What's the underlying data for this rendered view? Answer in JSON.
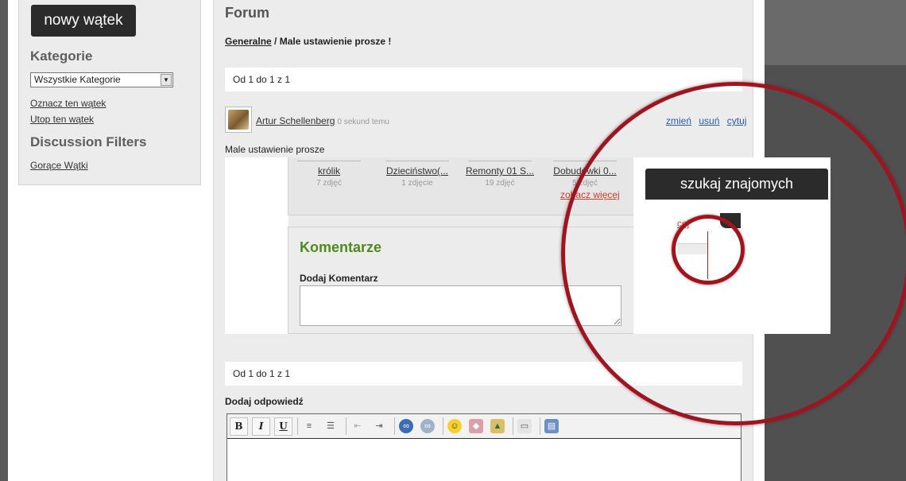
{
  "sidebar": {
    "new_thread_button": "nowy wątek",
    "categories_heading": "Kategorie",
    "category_select": "Wszystkie Kategorie",
    "links": [
      "Oznacz ten wątek",
      "Utop ten wątek"
    ],
    "filters_heading": "Discussion Filters",
    "filter_links": [
      "Gorące Wątki"
    ]
  },
  "main": {
    "title": "Forum",
    "breadcrumb": {
      "link": "Generalne",
      "separator": " / ",
      "current": "Male ustawienie prosze !"
    },
    "pager_top": "Od 1 do 1 z 1",
    "post": {
      "author": "Artur Schellenberg",
      "time": "0 sekund temu",
      "actions": [
        "zmień",
        "usuń",
        "cytuj"
      ],
      "text": "Male ustawienie prosze"
    },
    "albums": [
      {
        "name": "królik",
        "count": "7 zdjęć"
      },
      {
        "name": "Dzieciństwo(...",
        "count": "1 zdjęcie"
      },
      {
        "name": "Remonty 01 S...",
        "count": "19 zdjęć"
      },
      {
        "name": "Dobudówki 0...",
        "count": "5 zdjęć"
      }
    ],
    "see_more": "zobacz więcej",
    "comments": {
      "heading": "Komentarze",
      "add_label": "Dodaj Komentarz"
    },
    "pager_bottom": "Od 1 do 1 z 1",
    "reply_label": "Dodaj odpowiedź",
    "toolbar": {
      "bold": "B",
      "italic": "I",
      "underline": "U"
    }
  },
  "magnifier": {
    "find_friends_button": "szukaj znajomych",
    "partial_link": "cej"
  },
  "colors": {
    "accent_green": "#4e8a1f",
    "link_red": "#d23a2a",
    "link_blue": "#2a5aa8",
    "circle_red": "#9c1622",
    "dark_button": "#2b2b2b"
  }
}
